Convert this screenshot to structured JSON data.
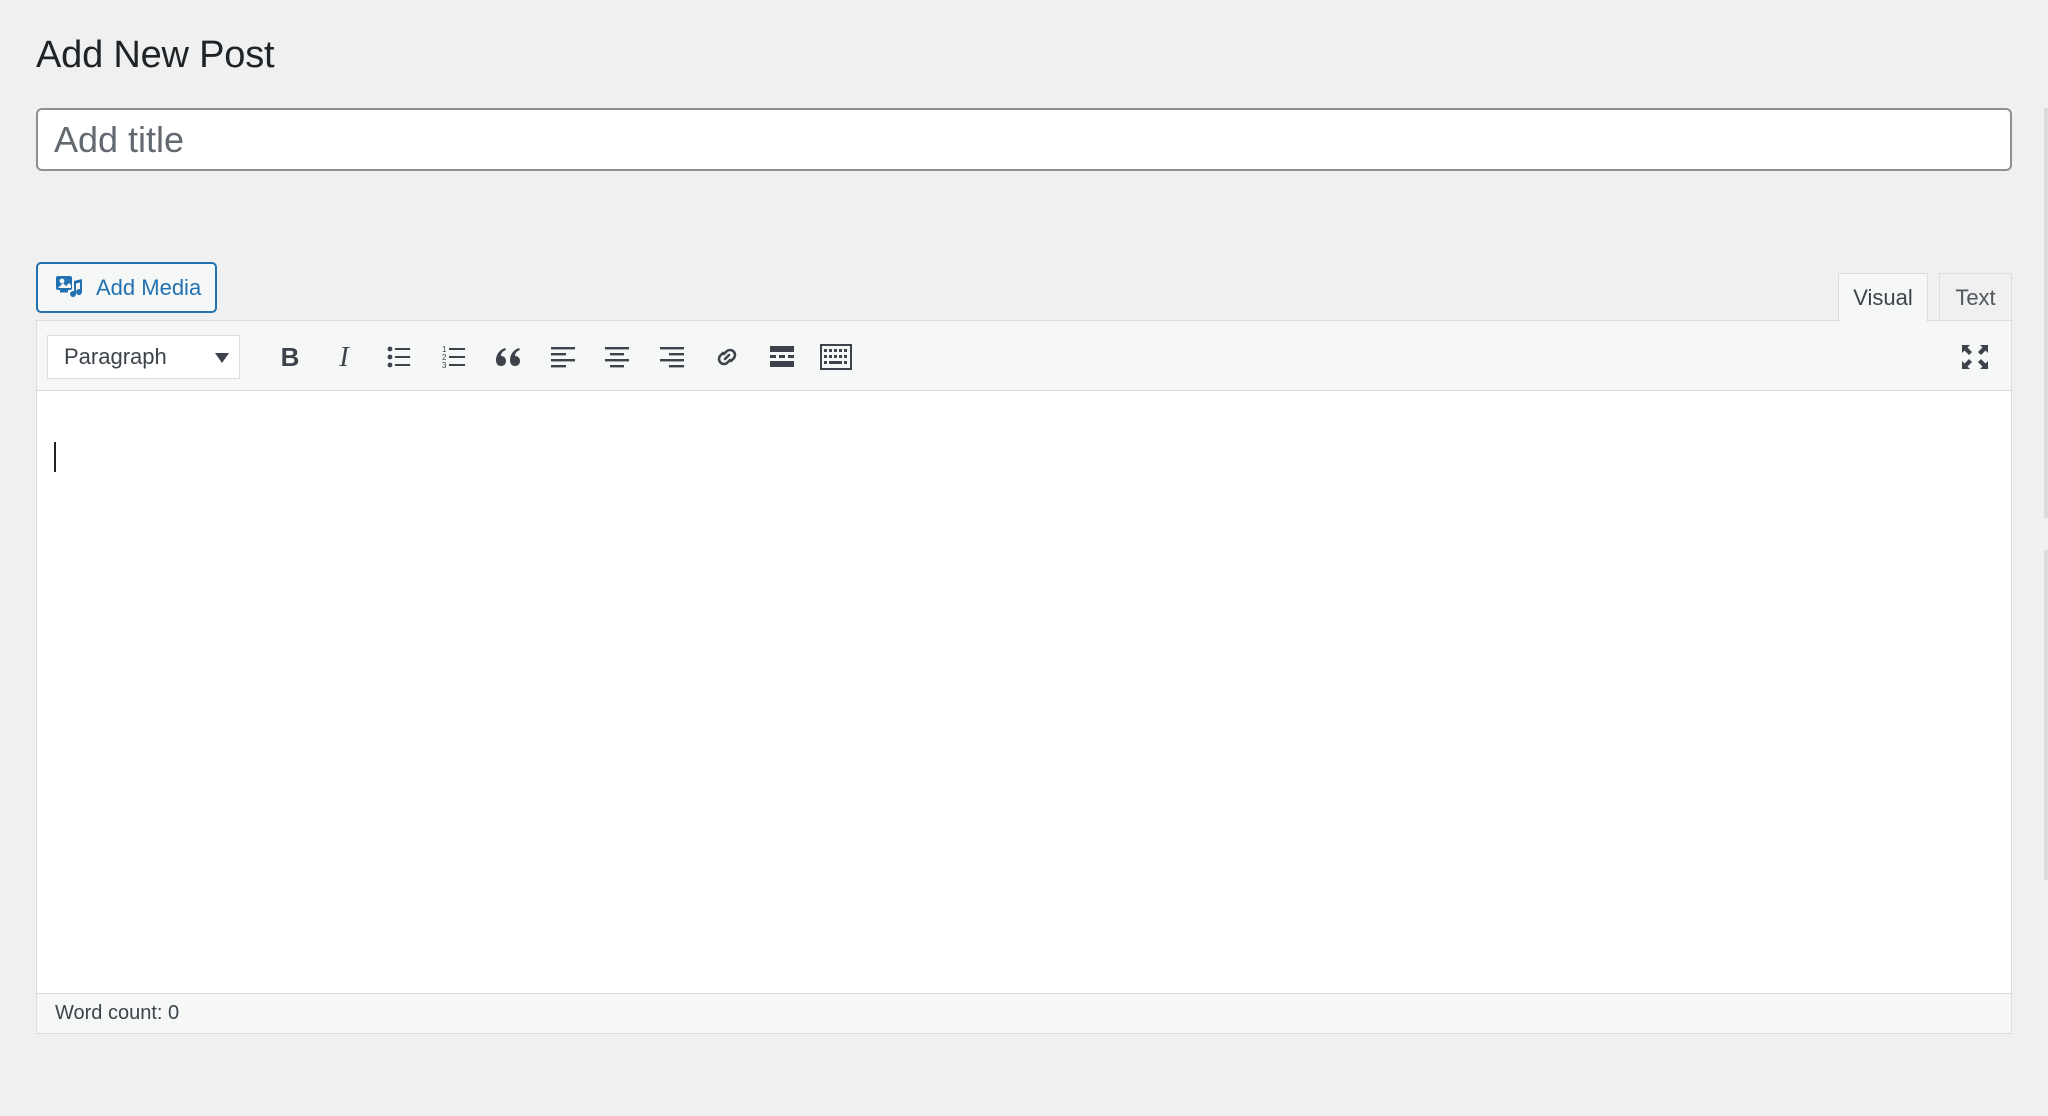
{
  "page": {
    "title": "Add New Post"
  },
  "title_field": {
    "placeholder": "Add title",
    "value": ""
  },
  "media": {
    "add_media_label": "Add Media",
    "icon": "add-media-icon"
  },
  "editor_tabs": [
    {
      "label": "Visual",
      "active": true
    },
    {
      "label": "Text",
      "active": false
    }
  ],
  "toolbar": {
    "format_select": {
      "selected": "Paragraph",
      "options": [
        "Paragraph"
      ]
    },
    "buttons": [
      {
        "name": "bold",
        "icon": "bold-icon"
      },
      {
        "name": "italic",
        "icon": "italic-icon"
      },
      {
        "name": "bulleted-list",
        "icon": "bulleted-list-icon"
      },
      {
        "name": "numbered-list",
        "icon": "numbered-list-icon"
      },
      {
        "name": "blockquote",
        "icon": "blockquote-icon"
      },
      {
        "name": "align-left",
        "icon": "align-left-icon"
      },
      {
        "name": "align-center",
        "icon": "align-center-icon"
      },
      {
        "name": "align-right",
        "icon": "align-right-icon"
      },
      {
        "name": "insert-link",
        "icon": "link-icon"
      },
      {
        "name": "read-more",
        "icon": "read-more-icon"
      },
      {
        "name": "toolbar-toggle",
        "icon": "keyboard-icon"
      },
      {
        "name": "fullscreen",
        "icon": "fullscreen-icon"
      }
    ]
  },
  "content": {
    "text": ""
  },
  "status": {
    "word_count_label": "Word count: 0"
  },
  "colors": {
    "background": "#f0f0f1",
    "accent": "#2271b1",
    "text": "#1d2327",
    "border": "#dcdcde"
  }
}
